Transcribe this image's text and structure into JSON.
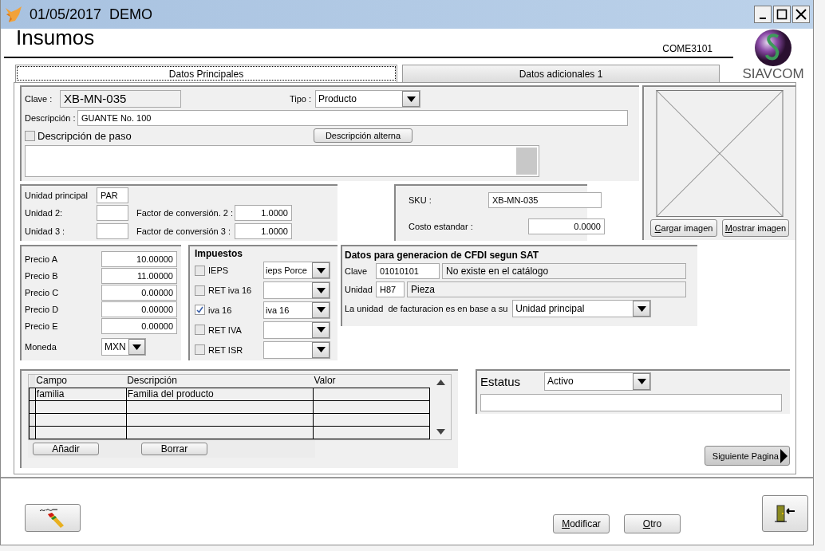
{
  "window": {
    "title": "01/05/2017  DEMO"
  },
  "header": {
    "title": "Insumos",
    "form_code": "COME3101",
    "logo_text": "SIAVCOM"
  },
  "tabs": [
    {
      "label": "Datos Principales",
      "selected": true
    },
    {
      "label": "Datos adicionales 1",
      "selected": false
    }
  ],
  "general": {
    "clave": {
      "label": "Clave :",
      "value": "XB-MN-035"
    },
    "tipo": {
      "label": "Tipo :",
      "value": "Producto"
    },
    "descripcion": {
      "label": "Descripción :",
      "value": "GUANTE No. 100"
    },
    "paso": {
      "label": "Descripción de paso",
      "checked": false
    },
    "alterna_button": "Descripción alterna"
  },
  "image_panel": {
    "buttons": [
      "Cargar imagen",
      "Mostrar imagen"
    ]
  },
  "units": [
    {
      "label": "Unidad principal",
      "value": "PAR"
    },
    {
      "label": "Unidad 2:",
      "factor_label": "Factor de conversión. 2 :",
      "factor": "1.0000"
    },
    {
      "label": "Unidad 3 :",
      "factor_label": "Factor de conversión 3 :",
      "factor": "1.0000"
    }
  ],
  "sku": {
    "sku_label": "SKU :",
    "sku": "XB-MN-035",
    "cost_label": "Costo estandar :",
    "cost": "0.0000"
  },
  "prices": [
    {
      "label": "Precio A",
      "value": "10.00000"
    },
    {
      "label": "Precio B",
      "value": "11.00000"
    },
    {
      "label": "Precio C",
      "value": "0.00000"
    },
    {
      "label": "Precio D",
      "value": "0.00000"
    },
    {
      "label": "Precio E",
      "value": "0.00000"
    }
  ],
  "currency": {
    "label": "Moneda",
    "value": "MXN"
  },
  "taxes": {
    "title": "Impuestos",
    "items": [
      {
        "label": "IEPS",
        "checked": false,
        "value": "ieps Porce"
      },
      {
        "label": "RET iva 16",
        "checked": false
      },
      {
        "label": "iva 16",
        "checked": true,
        "value": "iva 16"
      },
      {
        "label": "RET IVA",
        "checked": false
      },
      {
        "label": "RET ISR",
        "checked": false
      }
    ]
  },
  "cfdi": {
    "title": "Datos para generacion de CFDI segun SAT",
    "clave_label": "Clave",
    "clave": "01010101",
    "clave_desc": "No existe en el catálogo",
    "unidad_label": "Unidad",
    "unidad": "H87",
    "unidad_desc": "Pieza",
    "base_label": "La unidad  de facturacion es en base a su",
    "base": "Unidad principal"
  },
  "extra_fields": {
    "columns": [
      "Campo",
      "Descripción",
      "Valor"
    ],
    "rows": [
      {
        "campo": "familia",
        "descripcion": "Familia del producto"
      }
    ],
    "buttons": [
      "Añadir",
      "Borrar"
    ]
  },
  "status": {
    "label": "Estatus",
    "value": "Activo"
  },
  "next_button": "Siguiente Pagina",
  "footer_buttons": [
    "Modificar",
    "Otro"
  ]
}
